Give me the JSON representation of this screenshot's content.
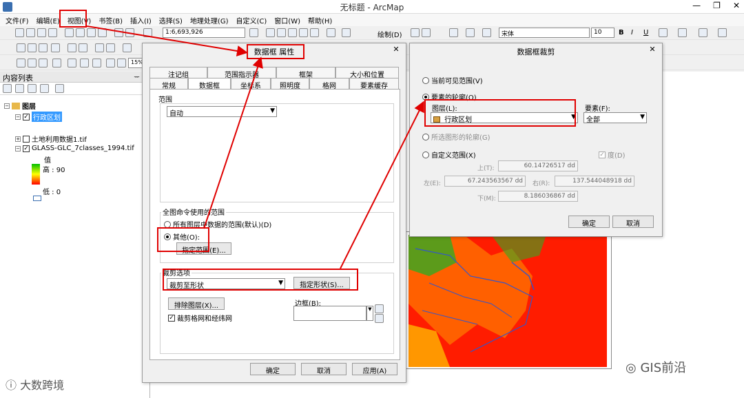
{
  "window": {
    "title": "无标题 - ArcMap",
    "minimize": "—",
    "restore": "❐",
    "close": "✕"
  },
  "menu": [
    "文件(F)",
    "编辑(E)",
    "视图(V)",
    "书签(B)",
    "插入(I)",
    "选择(S)",
    "地理处理(G)",
    "自定义(C)",
    "窗口(W)",
    "帮助(H)"
  ],
  "toolbar": {
    "scale": "1:6,693,926",
    "draw_label": "绘制(D)",
    "font_name": "宋体",
    "font_size": "10",
    "zoom": "15%"
  },
  "toc": {
    "title": "内容列表",
    "root": "图层",
    "layers": [
      "行政区划",
      "土地利用数据1.tif",
      "GLASS-GLC_7classes_1994.tif"
    ],
    "value_label": "值",
    "high": "高 : 90",
    "low": "低 : 0"
  },
  "props_dialog": {
    "title": "数据框 属性",
    "tabs_top": [
      "注记组",
      "范围指示器",
      "框架",
      "大小和位置"
    ],
    "tabs_bottom": [
      "常规",
      "数据框",
      "坐标系",
      "照明度",
      "格网",
      "要素缓存"
    ],
    "extent_label": "范围",
    "extent_value": "自动",
    "full_extent_label": "全图命令使用的范围",
    "opt_all": "所有图层中数据的范围(默认)(D)",
    "opt_other": "其他(O):",
    "specify_extent": "指定范围(E)...",
    "clip_label": "裁剪选项",
    "clip_value": "裁剪至形状",
    "specify_shape": "指定形状(S)...",
    "exclude_layers": "排除图层(X)...",
    "border_label": "边框(B):",
    "clip_grid": "裁剪格网和经纬网",
    "ok": "确定",
    "cancel": "取消",
    "apply": "应用(A)"
  },
  "clip_dialog": {
    "title": "数据框裁剪",
    "opt_visible": "当前可见范围(V)",
    "opt_outline": "要素的轮廓(O)",
    "layer_label": "图层(L):",
    "layer_value": "行政区划",
    "feature_label": "要素(F):",
    "feature_value": "全部",
    "opt_selected": "所选图形的轮廓(G)",
    "opt_custom": "自定义范围(X)",
    "degree": "度(D)",
    "top_label": "上(T):",
    "top_value": "60.14726517 dd",
    "left_label": "左(E):",
    "left_value": "67.243563567 dd",
    "right_label": "右(R):",
    "right_value": "137.544048918 dd",
    "bottom_label": "下(M):",
    "bottom_value": "8.186036867 dd",
    "ok": "确定",
    "cancel": "取消"
  },
  "watermarks": {
    "left": "大数跨境",
    "right": "GIS前沿"
  },
  "colors": {
    "annotation": "#e00000",
    "raster_red": "#ff1c00",
    "raster_orange": "#ff9900",
    "selection": "#3399ff"
  }
}
